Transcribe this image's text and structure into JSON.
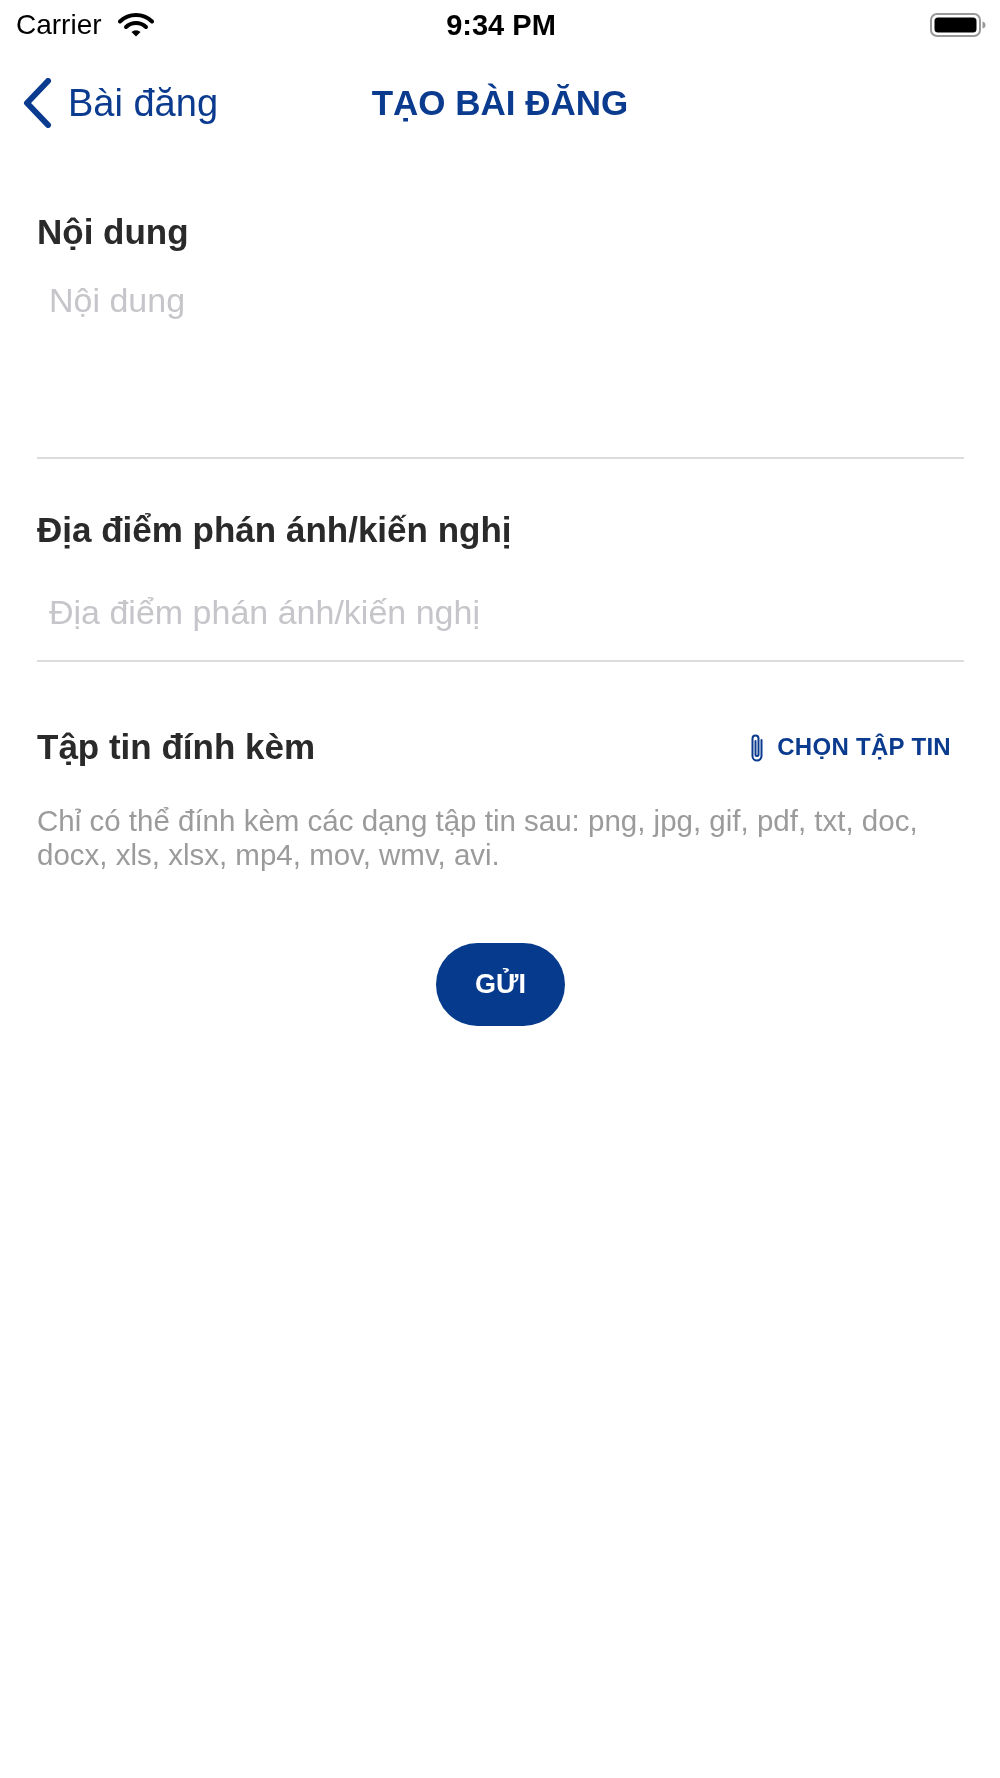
{
  "status_bar": {
    "carrier": "Carrier",
    "time": "9:34 PM"
  },
  "nav_bar": {
    "back_label": "Bài đăng",
    "title": "TẠO BÀI ĐĂNG"
  },
  "form": {
    "fields": [
      {
        "kind": "multiline",
        "label": "Nội dung",
        "placeholder": "Nội dung"
      },
      {
        "kind": "single_line",
        "label": "Địa điểm phán ánh/kiến nghị",
        "placeholder": "Địa điểm phán ánh/kiến nghị"
      }
    ],
    "attachments": {
      "label": "Tập tin đính kèm",
      "action": "CHỌN TẬP TIN",
      "hint": "Chỉ có thể đính kèm các dạng tập tin sau: png, jpg, gif, pdf, txt, doc, docx, xls, xlsx, mp4, mov, wmv, avi."
    },
    "submit_button": "GỬI"
  }
}
